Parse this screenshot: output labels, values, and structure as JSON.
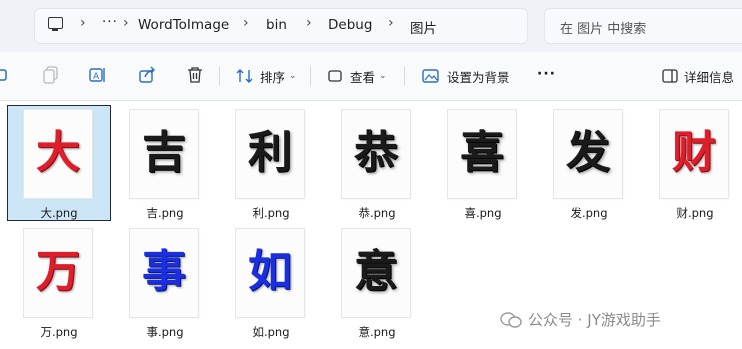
{
  "breadcrumb": {
    "items": [
      {
        "label": "WordToImage"
      },
      {
        "label": "bin"
      },
      {
        "label": "Debug"
      },
      {
        "label": "图片"
      }
    ],
    "more": "···"
  },
  "search": {
    "placeholder": "在 图片 中搜索"
  },
  "toolbar": {
    "sort_label": "排序",
    "view_label": "查看",
    "set_background_label": "设置为背景",
    "more_label": "···",
    "details_label": "详细信息"
  },
  "files": [
    {
      "glyph": "大",
      "name": "大.png",
      "color": "red",
      "selected": true
    },
    {
      "glyph": "吉",
      "name": "吉.png",
      "color": "black"
    },
    {
      "glyph": "利",
      "name": "利.png",
      "color": "black"
    },
    {
      "glyph": "恭",
      "name": "恭.png",
      "color": "black"
    },
    {
      "glyph": "喜",
      "name": "喜.png",
      "color": "black"
    },
    {
      "glyph": "发",
      "name": "发.png",
      "color": "black"
    },
    {
      "glyph": "财",
      "name": "财.png",
      "color": "red"
    },
    {
      "glyph": "万",
      "name": "万.png",
      "color": "red"
    },
    {
      "glyph": "事",
      "name": "事.png",
      "color": "blue"
    },
    {
      "glyph": "如",
      "name": "如.png",
      "color": "blue"
    },
    {
      "glyph": "意",
      "name": "意.png",
      "color": "black"
    }
  ],
  "watermark": {
    "text": "公众号 · JY游戏助手"
  },
  "colors": {
    "selection": "#cde6f7",
    "red": "#e01e2a",
    "blue": "#1a2fe0",
    "black": "#1a1a1a",
    "accent": "#0067c0"
  }
}
